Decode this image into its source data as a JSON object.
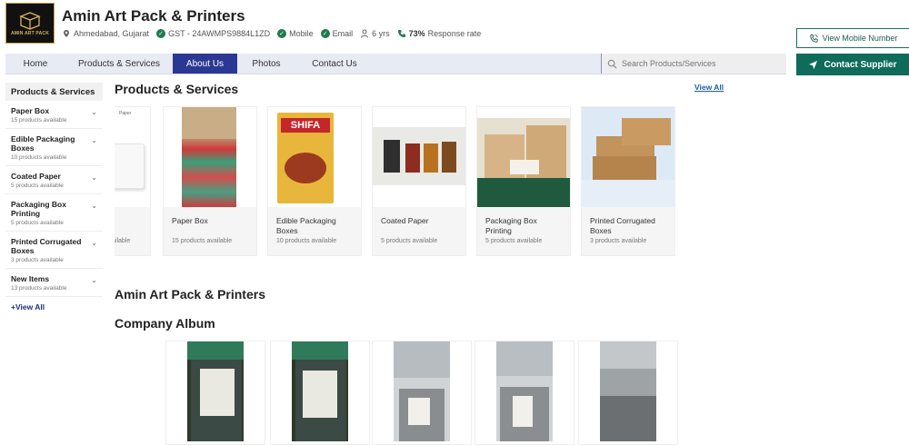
{
  "header": {
    "logo_text": "AMIN ART PACK",
    "company_name": "Amin Art Pack & Printers",
    "location": "Ahmedabad, Gujarat",
    "gst": "GST - 24AWMPS9884L1ZD",
    "mobile": "Mobile",
    "email": "Email",
    "years": "6 yrs",
    "response_rate": "73%",
    "response_label": "Response rate"
  },
  "actions": {
    "view_mobile": "View Mobile Number",
    "contact_supplier": "Contact Supplier"
  },
  "nav": {
    "items": [
      "Home",
      "Products & Services",
      "About Us",
      "Photos",
      "Contact Us"
    ],
    "active": "About Us",
    "search_placeholder": "Search Products/Services"
  },
  "sidebar": {
    "title": "Products & Services",
    "items": [
      {
        "name": "Paper Box",
        "count": "15 products available"
      },
      {
        "name": "Edible Packaging Boxes",
        "count": "10 products available"
      },
      {
        "name": "Coated Paper",
        "count": "5 products available"
      },
      {
        "name": "Packaging Box Printing",
        "count": "5 products available"
      },
      {
        "name": "Printed Corrugated Boxes",
        "count": "3 products available"
      },
      {
        "name": "New Items",
        "count": "13 products available"
      }
    ],
    "view_all": "+View All"
  },
  "products": {
    "title": "Products & Services",
    "view_all": "View All",
    "partial_label": "Paper",
    "partial_sub": "ailable",
    "cards": [
      {
        "name": "Paper Box",
        "count": "15 products available"
      },
      {
        "name": "Edible Packaging Boxes",
        "count": "10 products available"
      },
      {
        "name": "Coated Paper",
        "count": "5 products available"
      },
      {
        "name": "Packaging Box Printing",
        "count": "5 products available"
      },
      {
        "name": "Printed Corrugated Boxes",
        "count": "3 products available"
      }
    ]
  },
  "about": {
    "title": "Amin Art Pack & Printers"
  },
  "album": {
    "title": "Company Album"
  },
  "colors": {
    "nav_active": "#2b3893",
    "contact_button": "#0f6b5a",
    "link": "#1b5fa0"
  }
}
